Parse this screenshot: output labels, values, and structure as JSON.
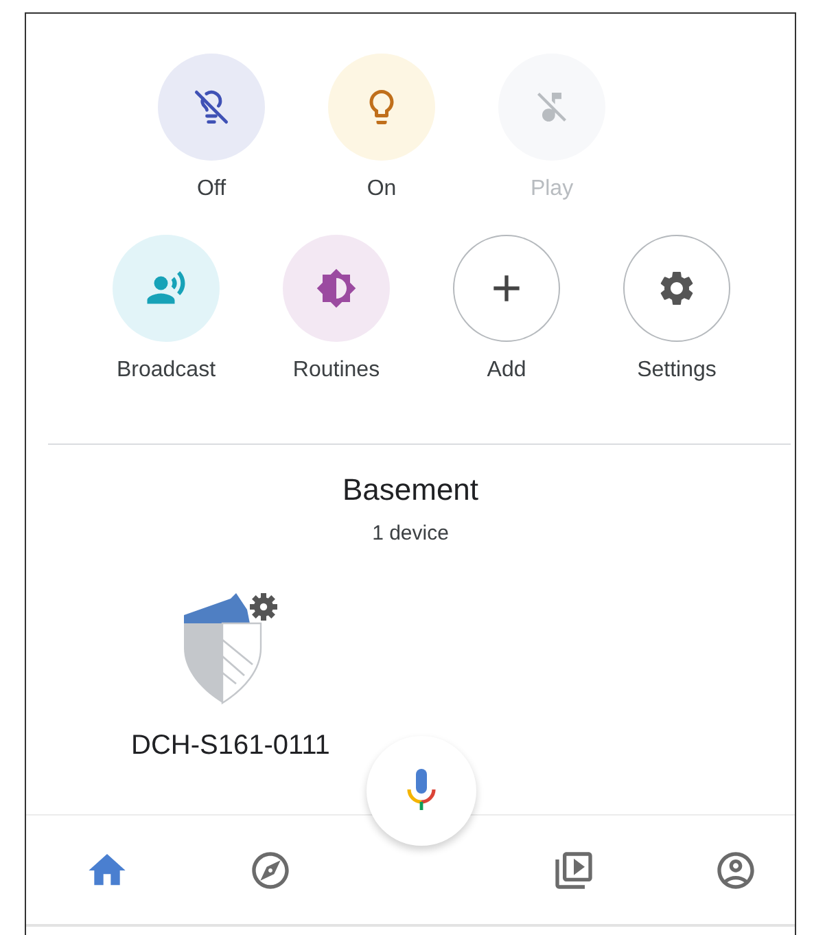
{
  "quick_actions": [
    {
      "label": "Off",
      "color": "#e8eaf6",
      "disabled": false
    },
    {
      "label": "On",
      "color": "#fdf6e3",
      "disabled": false
    },
    {
      "label": "Play",
      "color": "#f7f8fa",
      "disabled": true
    }
  ],
  "shortcuts": [
    {
      "label": "Broadcast",
      "kind": "filled",
      "color": "#e2f4f8"
    },
    {
      "label": "Routines",
      "kind": "filled",
      "color": "#f3e8f3"
    },
    {
      "label": "Add",
      "kind": "outlined"
    },
    {
      "label": "Settings",
      "kind": "outlined"
    }
  ],
  "room": {
    "title": "Basement",
    "subtitle": "1 device"
  },
  "devices": [
    {
      "name": "DCH-S161-0111"
    }
  ],
  "nav": [
    {
      "selected": true
    },
    {
      "selected": false
    },
    {
      "selected": false
    },
    {
      "selected": false
    }
  ]
}
